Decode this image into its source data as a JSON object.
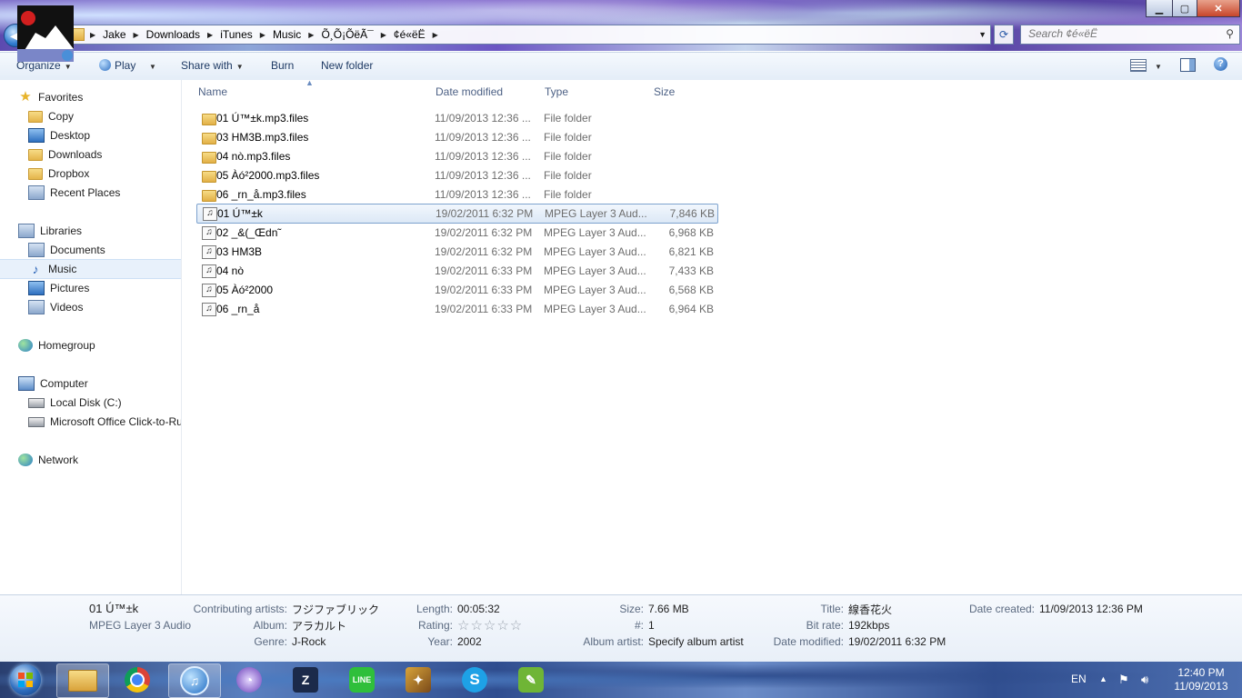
{
  "window": {
    "controls": {
      "minimize": "▁",
      "maximize": "▢",
      "close": "✕"
    }
  },
  "address": {
    "crumbs": [
      "Jake",
      "Downloads",
      "iTunes",
      "Music",
      "Õ¸Õ¡ÕëÃ¯",
      "¢é«ëË"
    ],
    "search_placeholder": "Search ¢é«ëË"
  },
  "toolbar": {
    "organize": "Organize",
    "play": "Play",
    "share_with": "Share with",
    "burn": "Burn",
    "new_folder": "New folder",
    "help": "?"
  },
  "nav": {
    "favorites": "Favorites",
    "favorites_items": [
      "Copy",
      "Desktop",
      "Downloads",
      "Dropbox",
      "Recent Places"
    ],
    "libraries": "Libraries",
    "libraries_items": [
      "Documents",
      "Music",
      "Pictures",
      "Videos"
    ],
    "homegroup": "Homegroup",
    "computer": "Computer",
    "computer_items": [
      "Local Disk (C:)",
      "Microsoft Office Click-to-Ru"
    ],
    "network": "Network"
  },
  "columns": {
    "name": "Name",
    "date": "Date modified",
    "type": "Type",
    "size": "Size"
  },
  "files": [
    {
      "name": "01 Ú™±k.mp3.files",
      "date": "11/09/2013 12:36 ...",
      "type": "File folder",
      "size": "",
      "kind": "folder"
    },
    {
      "name": "03 HM3B.mp3.files",
      "date": "11/09/2013 12:36 ...",
      "type": "File folder",
      "size": "",
      "kind": "folder"
    },
    {
      "name": "04 nò.mp3.files",
      "date": "11/09/2013 12:36 ...",
      "type": "File folder",
      "size": "",
      "kind": "folder"
    },
    {
      "name": "05 Àó²2000.mp3.files",
      "date": "11/09/2013 12:36 ...",
      "type": "File folder",
      "size": "",
      "kind": "folder"
    },
    {
      "name": "06 _rn_å.mp3.files",
      "date": "11/09/2013 12:36 ...",
      "type": "File folder",
      "size": "",
      "kind": "folder"
    },
    {
      "name": "01 Ú™±k",
      "date": "19/02/2011 6:32 PM",
      "type": "MPEG Layer 3 Aud...",
      "size": "7,846 KB",
      "kind": "audio"
    },
    {
      "name": "02 _&(_Œdn˜",
      "date": "19/02/2011 6:32 PM",
      "type": "MPEG Layer 3 Aud...",
      "size": "6,968 KB",
      "kind": "audio"
    },
    {
      "name": "03 HM3B",
      "date": "19/02/2011 6:32 PM",
      "type": "MPEG Layer 3 Aud...",
      "size": "6,821 KB",
      "kind": "audio"
    },
    {
      "name": "04 nò",
      "date": "19/02/2011 6:33 PM",
      "type": "MPEG Layer 3 Aud...",
      "size": "7,433 KB",
      "kind": "audio"
    },
    {
      "name": "05 Àó²2000",
      "date": "19/02/2011 6:33 PM",
      "type": "MPEG Layer 3 Aud...",
      "size": "6,568 KB",
      "kind": "audio"
    },
    {
      "name": "06 _rn_å",
      "date": "19/02/2011 6:33 PM",
      "type": "MPEG Layer 3 Aud...",
      "size": "6,964 KB",
      "kind": "audio"
    }
  ],
  "details": {
    "title": "01 Ú™±k",
    "subtitle": "MPEG Layer 3 Audio",
    "labels": {
      "contributing_artists": "Contributing artists:",
      "album": "Album:",
      "genre": "Genre:",
      "length": "Length:",
      "rating": "Rating:",
      "year": "Year:",
      "size": "Size:",
      "track": "#:",
      "album_artist": "Album artist:",
      "title": "Title:",
      "bit_rate": "Bit rate:",
      "date_modified": "Date modified:",
      "date_created": "Date created:"
    },
    "values": {
      "contributing_artists": "フジファブリック",
      "album": "アラカルト",
      "genre": "J-Rock",
      "length": "00:05:32",
      "rating_stars": "☆☆☆☆☆",
      "year": "2002",
      "size": "7.66 MB",
      "track": "1",
      "album_artist": "Specify album artist",
      "title": "線香花火",
      "bit_rate": "192kbps",
      "date_modified": "19/02/2011 6:32 PM",
      "date_created": "11/09/2013 12:36 PM"
    }
  },
  "taskbar": {
    "language": "EN",
    "time": "12:40 PM",
    "date": "11/09/2013"
  },
  "colors": {
    "selection": "#dce8f6",
    "link_text": "#1e3a64",
    "detail_label": "#5b6a80"
  }
}
